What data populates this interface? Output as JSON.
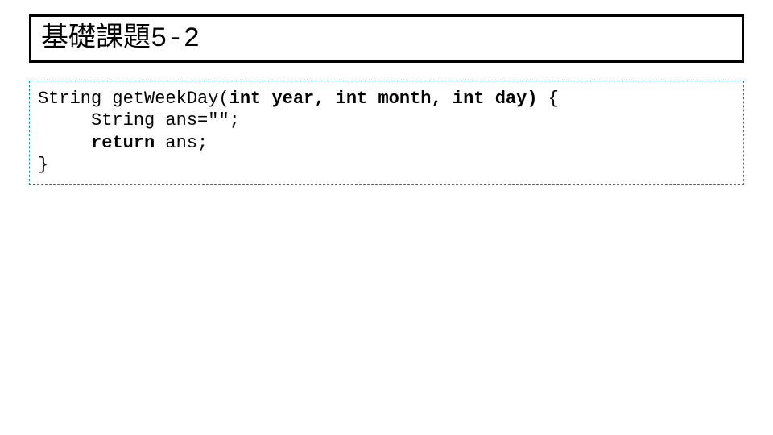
{
  "title": {
    "cjk": "基礎課題",
    "number": "5-2"
  },
  "code": {
    "line1_a": "String getWeekDay(",
    "line1_b": "int year,",
    "line1_c": " ",
    "line1_d": "int month,",
    "line1_e": " ",
    "line1_f": "int day)",
    "line1_g": " {",
    "line2_indent": "     ",
    "line2": "String ans=\"\";",
    "line3_indent": "     ",
    "line3_a": "return",
    "line3_b": " ans;",
    "line4": "}"
  }
}
